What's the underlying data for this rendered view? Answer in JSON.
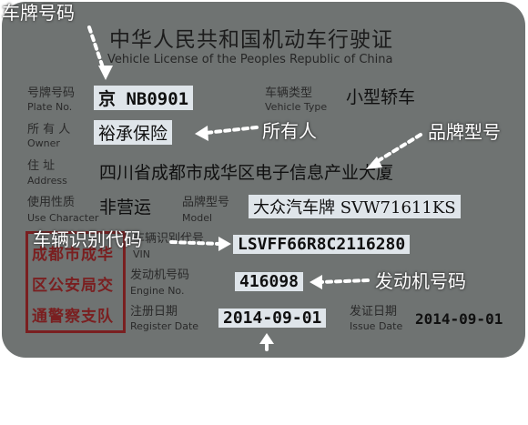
{
  "card": {
    "title_cn": "中华人民共和国机动车行驶证",
    "title_en": "Vehicle License of the Peoples Republic of China",
    "plate_label": "号牌号码",
    "plate_label_en": "Plate No.",
    "plate_value": "京 NB0901",
    "vehicle_type_label": "车辆类型",
    "vehicle_type_label_en": "Vehicle Type",
    "vehicle_type_value": "小型轿车",
    "owner_label": "所 有 人",
    "owner_label_en": "Owner",
    "owner_value": "裕承保险",
    "address_label": "住 址",
    "address_label_en": "Address",
    "address_value": "四川省成都市成华区电子信息产业大厦",
    "use_label": "使用性质",
    "use_label_en": "Use Character",
    "use_value": "非营运",
    "model_label": "品牌型号",
    "model_label_en": "Model",
    "model_value": "大众汽车牌 SVW71611KS",
    "vin_label": "车辆识别代号",
    "vin_label_en": "VIN",
    "vin_value": "LSVFF66R8C2116280",
    "engine_label": "发动机号码",
    "engine_label_en": "Engine No.",
    "engine_value": "416098",
    "register_label": "注册日期",
    "register_label_en": "Register Date",
    "register_value": "2014-09-01",
    "issue_label": "发证日期",
    "issue_label_en": "Issue Date",
    "issue_value": "2014-09-01",
    "seal_lines": [
      "成都市成华",
      "区公安局交",
      "通警察支队"
    ]
  },
  "annotations": {
    "plate": "车牌号码",
    "owner": "所有人",
    "model": "品牌型号",
    "vin": "车辆识别代码",
    "engine": "发动机号码"
  },
  "colors": {
    "card_bg": "#6f7372",
    "highlight": "#dfe5ea",
    "seal": "#7a1f20"
  }
}
